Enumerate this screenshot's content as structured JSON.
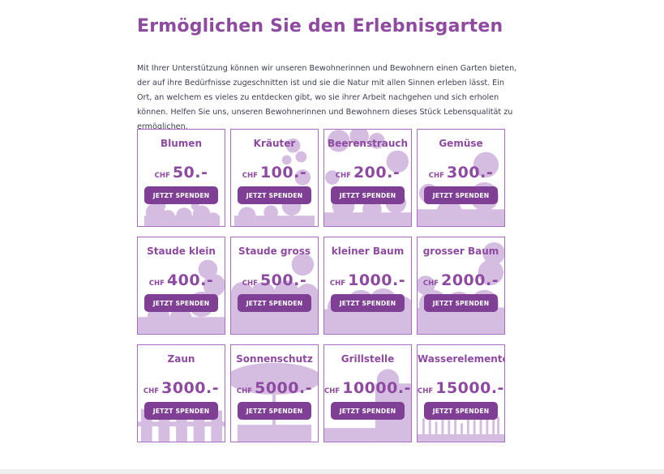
{
  "page": {
    "title": "Ermöglichen Sie den Erlebnisgarten",
    "intro": "Mit Ihrer Unterstützung können wir unseren Bewohnerinnen und Bewohnern einen Garten bieten, der auf ihre Bedürfnisse zugeschnitten ist und sie die Natur mit allen Sinnen erleben lässt. Ein Ort, an welchem es vieles zu entdecken gibt, wo sie ihrer Arbeit nachgehen und sich erholen können. Helfen Sie uns, unseren Bewohnerinnen und Bewohnern dieses Stück Lebensqualität zu ermöglichen."
  },
  "colors": {
    "accent": "#8e4aa0",
    "button": "#7e3f95",
    "illustration": "#d5bde2"
  },
  "donations": [
    {
      "title": "Blumen",
      "currency": "CHF",
      "amount": "50.-",
      "button": "JETZT SPENDEN",
      "illustration": "flowers"
    },
    {
      "title": "Kräuter",
      "currency": "CHF",
      "amount": "100.-",
      "button": "JETZT SPENDEN",
      "illustration": "herbs"
    },
    {
      "title": "Beerenstrauch",
      "currency": "CHF",
      "amount": "200.-",
      "button": "JETZT SPENDEN",
      "illustration": "berry-bush"
    },
    {
      "title": "Gemüse",
      "currency": "CHF",
      "amount": "300.-",
      "button": "JETZT SPENDEN",
      "illustration": "vegetables"
    },
    {
      "title": "Staude klein",
      "currency": "CHF",
      "amount": "400.-",
      "button": "JETZT SPENDEN",
      "illustration": "small-shrub"
    },
    {
      "title": "Staude gross",
      "currency": "CHF",
      "amount": "500.-",
      "button": "JETZT SPENDEN",
      "illustration": "large-shrub"
    },
    {
      "title": "kleiner Baum",
      "currency": "CHF",
      "amount": "1000.-",
      "button": "JETZT SPENDEN",
      "illustration": "small-tree"
    },
    {
      "title": "grosser Baum",
      "currency": "CHF",
      "amount": "2000.-",
      "button": "JETZT SPENDEN",
      "illustration": "large-tree"
    },
    {
      "title": "Zaun",
      "currency": "CHF",
      "amount": "3000.-",
      "button": "JETZT SPENDEN",
      "illustration": "fence"
    },
    {
      "title": "Sonnenschutz",
      "currency": "CHF",
      "amount": "5000.-",
      "button": "JETZT SPENDEN",
      "illustration": "sunshade"
    },
    {
      "title": "Grillstelle",
      "currency": "CHF",
      "amount": "10000.-",
      "button": "JETZT SPENDEN",
      "illustration": "grill"
    },
    {
      "title": "Wasserelemente",
      "currency": "CHF",
      "amount": "15000.-",
      "button": "JETZT SPENDEN",
      "illustration": "water-plants"
    }
  ]
}
